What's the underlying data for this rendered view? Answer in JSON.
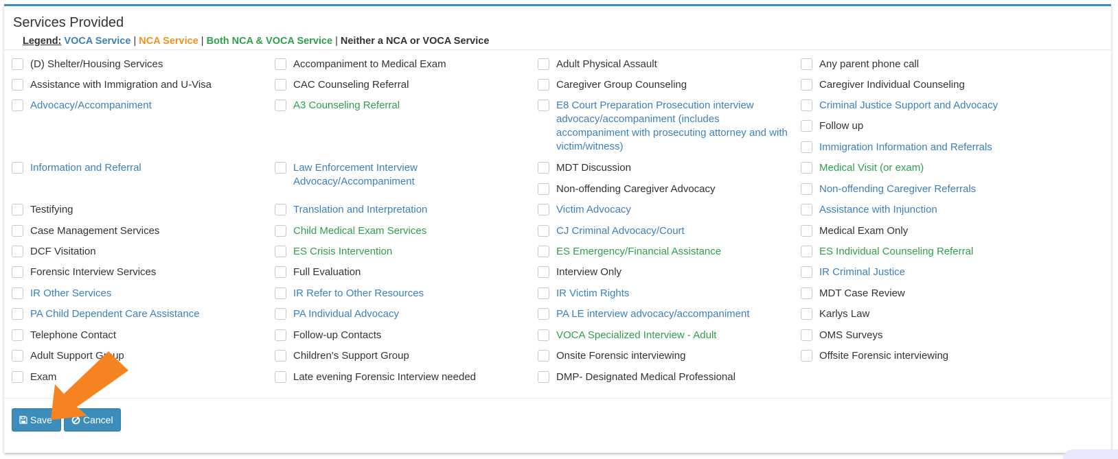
{
  "panel": {
    "title": "Services Provided",
    "legend": {
      "label": "Legend:",
      "voca": "VOCA Service",
      "nca": "NCA Service",
      "both": "Both NCA & VOCA Service",
      "neither": "Neither a NCA or VOCA Service",
      "sep": "|"
    }
  },
  "colors": {
    "voca": "#3c80bc",
    "nca": "#f5901e",
    "both": "#2ea04a",
    "none": "#333333",
    "accent": "#3c8dbc"
  },
  "services": [
    {
      "label": "(D) Shelter/Housing Services",
      "type": "none"
    },
    {
      "label": "Accompaniment to Medical Exam",
      "type": "none"
    },
    {
      "label": "Adult Physical Assault",
      "type": "none"
    },
    {
      "label": "Any parent phone call",
      "type": "none"
    },
    {
      "label": "Assistance with Immigration and U-Visa",
      "type": "none"
    },
    {
      "label": "CAC Counseling Referral",
      "type": "none"
    },
    {
      "label": "Caregiver Group Counseling",
      "type": "none"
    },
    {
      "label": "Caregiver Individual Counseling",
      "type": "none"
    },
    {
      "label": "Advocacy/Accompaniment",
      "type": "voca"
    },
    {
      "label": "A3 Counseling Referral",
      "type": "both"
    },
    {
      "label": "E8 Court Preparation Prosecution interview advocacy/accompaniment (includes accompaniment with prosecuting attorney and with victim/witness)",
      "type": "voca"
    },
    {
      "label": "Criminal Justice Support and Advocacy",
      "type": "voca"
    },
    {
      "label": "Follow up",
      "type": "none"
    },
    {
      "label": "Immigration Information and Referrals",
      "type": "voca"
    },
    {
      "label": "Information and Referral",
      "type": "voca"
    },
    {
      "label": "Law Enforcement Interview Advocacy/Accompaniment",
      "type": "voca"
    },
    {
      "label": "MDT Discussion",
      "type": "none"
    },
    {
      "label": "Medical Visit (or exam)",
      "type": "both"
    },
    {
      "label": "Non-offending Caregiver Advocacy",
      "type": "none"
    },
    {
      "label": "Non-offending Caregiver Referrals",
      "type": "voca"
    },
    {
      "label": "Testifying",
      "type": "none"
    },
    {
      "label": "Translation and Interpretation",
      "type": "voca"
    },
    {
      "label": "Victim Advocacy",
      "type": "voca"
    },
    {
      "label": "Assistance with Injunction",
      "type": "voca"
    },
    {
      "label": "Case Management Services",
      "type": "none"
    },
    {
      "label": "Child Medical Exam Services",
      "type": "both"
    },
    {
      "label": "CJ Criminal Advocacy/Court",
      "type": "voca"
    },
    {
      "label": "Medical Exam Only",
      "type": "none"
    },
    {
      "label": "DCF Visitation",
      "type": "none"
    },
    {
      "label": "ES Crisis Intervention",
      "type": "both"
    },
    {
      "label": "ES Emergency/Financial Assistance",
      "type": "both"
    },
    {
      "label": "ES Individual Counseling Referral",
      "type": "both"
    },
    {
      "label": "Forensic Interview Services",
      "type": "none"
    },
    {
      "label": "Full Evaluation",
      "type": "none"
    },
    {
      "label": "Interview Only",
      "type": "none"
    },
    {
      "label": "IR Criminal Justice",
      "type": "voca"
    },
    {
      "label": "IR Other Services",
      "type": "voca"
    },
    {
      "label": "IR Refer to Other Resources",
      "type": "voca"
    },
    {
      "label": "IR Victim Rights",
      "type": "voca"
    },
    {
      "label": "MDT Case Review",
      "type": "none"
    },
    {
      "label": "PA Child Dependent Care Assistance",
      "type": "voca"
    },
    {
      "label": "PA Individual Advocacy",
      "type": "voca"
    },
    {
      "label": "PA LE interview advocacy/accompaniment",
      "type": "voca"
    },
    {
      "label": "Karlys Law",
      "type": "none"
    },
    {
      "label": "Telephone Contact",
      "type": "none"
    },
    {
      "label": "Follow-up Contacts",
      "type": "none"
    },
    {
      "label": "VOCA Specialized Interview - Adult",
      "type": "both"
    },
    {
      "label": "OMS Surveys",
      "type": "none"
    },
    {
      "label": "Adult Support Group",
      "type": "none"
    },
    {
      "label": "Children's Support Group",
      "type": "none"
    },
    {
      "label": "Onsite Forensic interviewing",
      "type": "none"
    },
    {
      "label": "Offsite Forensic interviewing",
      "type": "none"
    },
    {
      "label": "Exam",
      "type": "none"
    },
    {
      "label": "Late evening Forensic Interview needed",
      "type": "none"
    },
    {
      "label": "DMP- Designated Medical Professional",
      "type": "none"
    }
  ],
  "footer": {
    "save_label": "Save",
    "cancel_label": "Cancel",
    "save_icon": "floppy-disk-icon",
    "cancel_icon": "ban-icon"
  },
  "annotation": {
    "arrow_color": "#f5831f",
    "arrow_target": "save-button"
  }
}
